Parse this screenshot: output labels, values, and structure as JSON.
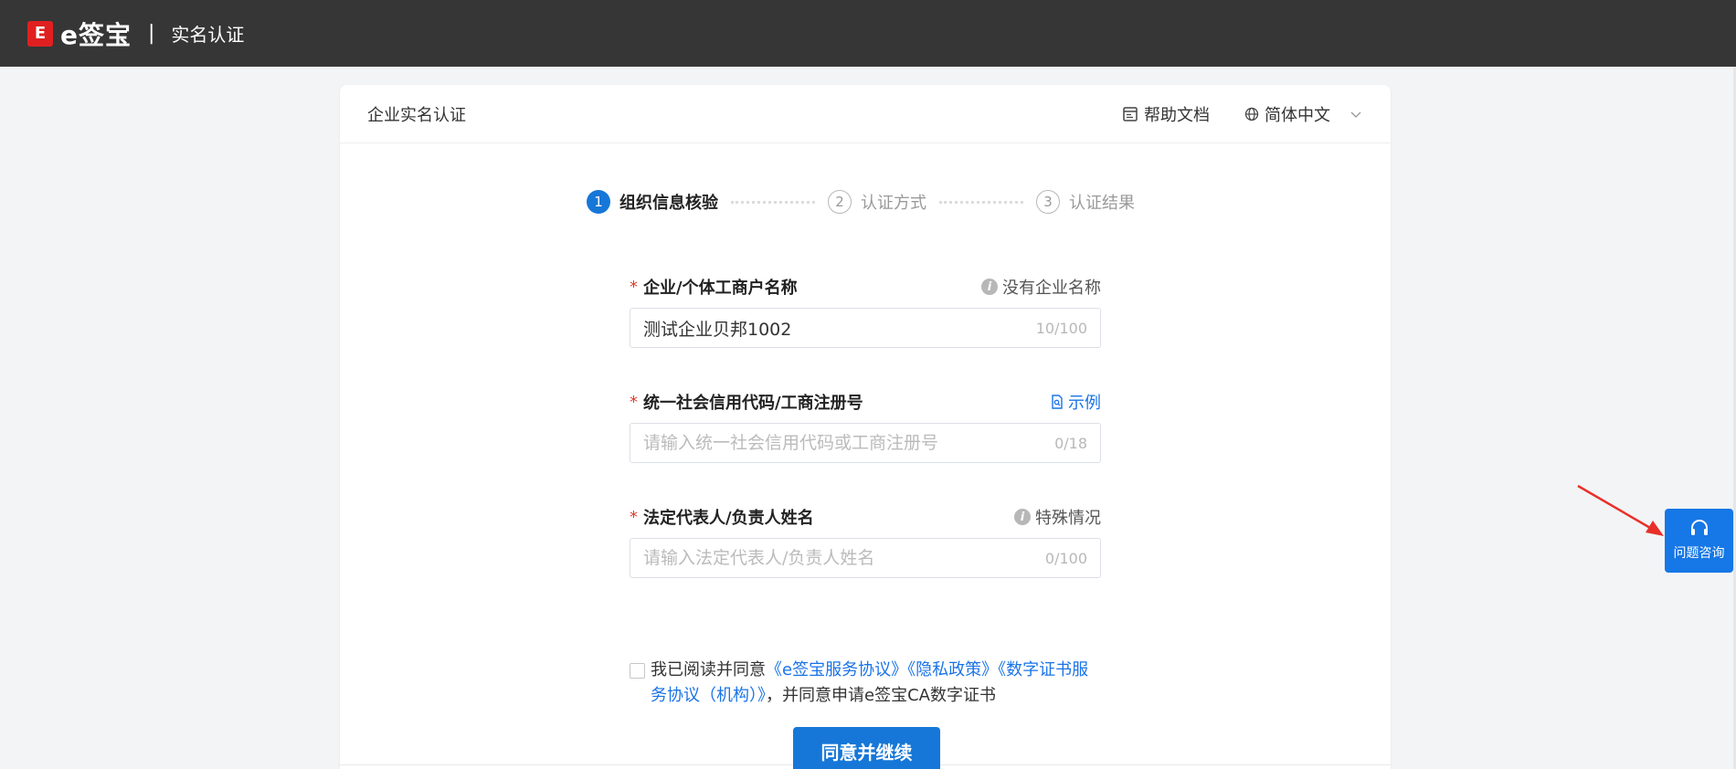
{
  "topbar": {
    "logo_mark": "E",
    "logo_text": "e签宝",
    "separator": "|",
    "page_title": "实名认证"
  },
  "card": {
    "title": "企业实名认证",
    "help_doc": "帮助文档",
    "language": "简体中文"
  },
  "steps": [
    {
      "num": "1",
      "label": "组织信息核验",
      "state": "active"
    },
    {
      "num": "2",
      "label": "认证方式",
      "state": "idle"
    },
    {
      "num": "3",
      "label": "认证结果",
      "state": "idle"
    }
  ],
  "form": {
    "company": {
      "required": "*",
      "label": "企业/个体工商户名称",
      "aside": "没有企业名称",
      "value": "测试企业贝邦1002",
      "counter": "10/100"
    },
    "credit_code": {
      "required": "*",
      "label": "统一社会信用代码/工商注册号",
      "aside": "示例",
      "placeholder": "请输入统一社会信用代码或工商注册号",
      "counter": "0/18"
    },
    "legal_rep": {
      "required": "*",
      "label": "法定代表人/负责人姓名",
      "aside": "特殊情况",
      "placeholder": "请输入法定代表人/负责人姓名",
      "counter": "0/100"
    }
  },
  "agreement": {
    "prefix": "我已阅读并同意",
    "link1": "《e签宝服务协议》",
    "link2": "《隐私政策》",
    "link3": "《数字证书服务协议（机构）》",
    "suffix": "，并同意申请e签宝CA数字证书"
  },
  "continue_button": "同意并继续",
  "help_float": {
    "label": "问题咨询"
  },
  "colors": {
    "topbar": "#363636",
    "primary": "#1677d8",
    "logo_red": "#e02020",
    "required_red": "#e23b2e",
    "arrow_red": "#e8302a"
  }
}
